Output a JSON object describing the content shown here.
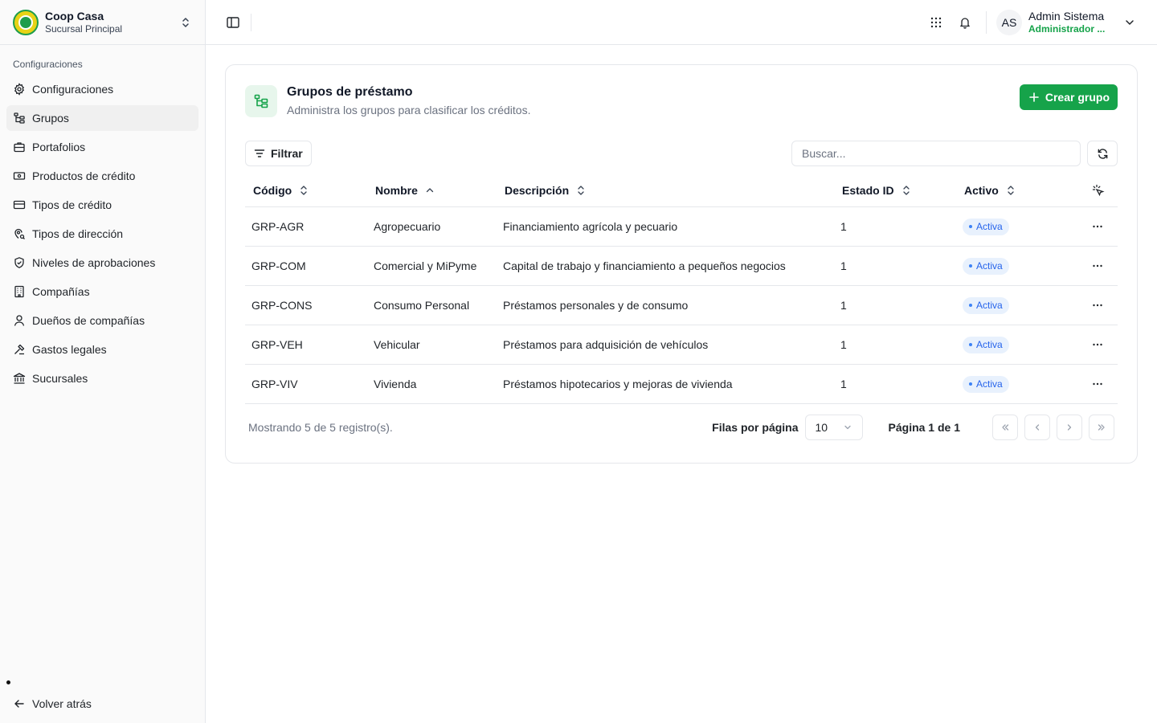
{
  "org": {
    "name": "Coop Casa",
    "branch": "Sucursal Principal"
  },
  "sidebar": {
    "section_label": "Configuraciones",
    "items": [
      {
        "label": "Configuraciones",
        "icon": "gear-icon"
      },
      {
        "label": "Grupos",
        "icon": "group-tree-icon",
        "active": true
      },
      {
        "label": "Portafolios",
        "icon": "briefcase-icon"
      },
      {
        "label": "Productos de crédito",
        "icon": "banknote-icon"
      },
      {
        "label": "Tipos de crédito",
        "icon": "credit-card-icon"
      },
      {
        "label": "Tipos de dirección",
        "icon": "map-pin-icon"
      },
      {
        "label": "Niveles de aprobaciones",
        "icon": "shield-check-icon"
      },
      {
        "label": "Compañías",
        "icon": "building-icon"
      },
      {
        "label": "Dueños de compañías",
        "icon": "user-icon"
      },
      {
        "label": "Gastos legales",
        "icon": "gavel-icon"
      },
      {
        "label": "Sucursales",
        "icon": "bank-icon"
      }
    ],
    "back_label": "Volver atrás"
  },
  "user": {
    "initials": "AS",
    "name": "Admin Sistema",
    "role": "Administrador ..."
  },
  "page": {
    "title": "Grupos de préstamo",
    "subtitle": "Administra los grupos para clasificar los créditos.",
    "create_label": "Crear grupo",
    "filter_label": "Filtrar",
    "search_placeholder": "Buscar..."
  },
  "table": {
    "columns": {
      "code": "Código",
      "name": "Nombre",
      "description": "Descripción",
      "estado": "Estado ID",
      "activo": "Activo"
    },
    "rows": [
      {
        "code": "GRP-AGR",
        "name": "Agropecuario",
        "description": "Financiamiento agrícola y pecuario",
        "estado": "1",
        "activo": "Activa"
      },
      {
        "code": "GRP-COM",
        "name": "Comercial y MiPyme",
        "description": "Capital de trabajo y financiamiento a pequeños negocios",
        "estado": "1",
        "activo": "Activa"
      },
      {
        "code": "GRP-CONS",
        "name": "Consumo Personal",
        "description": "Préstamos personales y de consumo",
        "estado": "1",
        "activo": "Activa"
      },
      {
        "code": "GRP-VEH",
        "name": "Vehicular",
        "description": "Préstamos para adquisición de vehículos",
        "estado": "1",
        "activo": "Activa"
      },
      {
        "code": "GRP-VIV",
        "name": "Vivienda",
        "description": "Préstamos hipotecarios y mejoras de vivienda",
        "estado": "1",
        "activo": "Activa"
      }
    ]
  },
  "footer": {
    "count_text": "Mostrando 5 de 5 registro(s).",
    "rows_label": "Filas por página",
    "rows_value": "10",
    "page_text": "Página 1 de 1"
  },
  "colors": {
    "accent": "#16a34a",
    "badge_bg": "#e8f1fd",
    "badge_text": "#2563eb"
  }
}
